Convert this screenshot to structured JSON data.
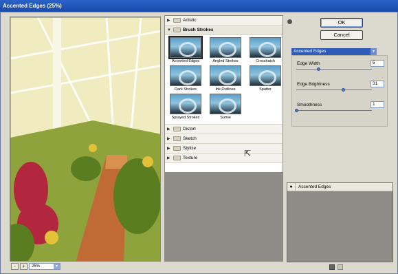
{
  "window": {
    "title": "Accented Edges (25%)"
  },
  "preview": {
    "zoom_value": "25%",
    "zoom_minus": "-",
    "zoom_plus": "+"
  },
  "gallery": {
    "categories_top": [
      {
        "label": "Artistic",
        "expanded": false
      }
    ],
    "open_category": {
      "label": "Brush Strokes",
      "expanded": true
    },
    "thumbnails": [
      {
        "label": "Accented Edges",
        "selected": true
      },
      {
        "label": "Angled Strokes",
        "selected": false
      },
      {
        "label": "Crosshatch",
        "selected": false
      },
      {
        "label": "Dark Strokes",
        "selected": false
      },
      {
        "label": "Ink Outlines",
        "selected": false
      },
      {
        "label": "Spatter",
        "selected": false
      },
      {
        "label": "Sprayed Strokes",
        "selected": false
      },
      {
        "label": "Sumie",
        "selected": false
      }
    ],
    "categories_bottom": [
      {
        "label": "Distort"
      },
      {
        "label": "Sketch"
      },
      {
        "label": "Stylize"
      },
      {
        "label": "Texture"
      }
    ]
  },
  "controls": {
    "ok_label": "OK",
    "cancel_label": "Cancel",
    "filter_select": "Accented Edges"
  },
  "params": [
    {
      "label": "Edge Width",
      "value": "5",
      "fraction": 0.29
    },
    {
      "label": "Edge Brightness",
      "value": "31",
      "fraction": 0.62
    },
    {
      "label": "Smoothness",
      "value": "1",
      "fraction": 0.0
    }
  ],
  "layers": {
    "items": [
      {
        "name": "Accented Edges",
        "visible": true
      }
    ]
  },
  "colors": {
    "title_bar": "#1f54b8",
    "selection": "#2e5cb8",
    "panel": "#dcd9cf"
  }
}
